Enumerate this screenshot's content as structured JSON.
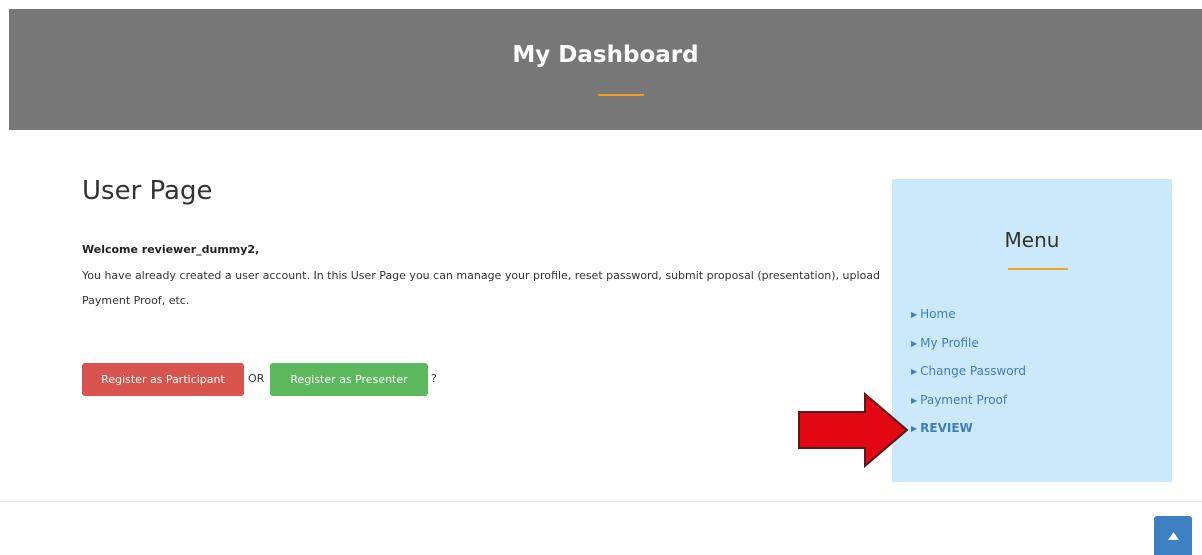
{
  "header": {
    "title": "My Dashboard"
  },
  "main": {
    "page_title": "User Page",
    "welcome": "Welcome reviewer_dummy2,",
    "intro": "You have already created a user account. In this User Page you can manage your profile, reset password, submit proposal (presentation), upload Payment Proof, etc.",
    "buttons": {
      "participant": "Register as Participant",
      "or_text": "OR",
      "presenter": "Register as Presenter",
      "question_mark": "?"
    }
  },
  "menu": {
    "title": "Menu",
    "items": [
      {
        "label": "Home"
      },
      {
        "label": "My Profile"
      },
      {
        "label": "Change Password"
      },
      {
        "label": "Payment Proof"
      },
      {
        "label": "REVIEW"
      }
    ]
  },
  "colors": {
    "banner": "#777777",
    "accent_line": "#f0a31a",
    "menu_bg": "#cce9fb",
    "link": "#3d7fb8",
    "btn_red": "#d9534f",
    "btn_green": "#5cb85c",
    "arrow": "#e30613",
    "scroll_button": "#3e7fc2"
  },
  "icons": {
    "menu_bullet": "caret-right-icon",
    "annotation": "red-arrow-icon",
    "scroll_top": "chevron-up-icon"
  }
}
